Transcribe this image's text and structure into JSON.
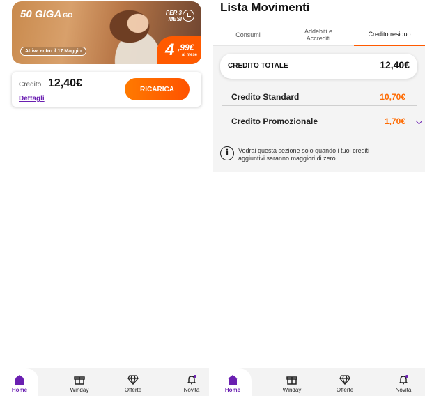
{
  "left": {
    "promo": {
      "giga": "50 GIGA",
      "go": "GO",
      "per_line1": "PER 3",
      "per_line2": "MESI",
      "attiva": "Attiva entro il 17 Maggio",
      "price_int": "4",
      "price_dec": ",99€",
      "price_suffix": "al mese"
    },
    "credit": {
      "label": "Credito",
      "value": "12,40€",
      "details_link": "Dettagli",
      "button": "RICARICA"
    }
  },
  "right": {
    "title": "Lista Movimenti",
    "tabs": [
      {
        "line1": "Consumi",
        "line2": ""
      },
      {
        "line1": "Addebiti e",
        "line2": "Accrediti"
      },
      {
        "line1": "Credito residuo",
        "line2": ""
      }
    ],
    "total": {
      "label": "CREDITO TOTALE",
      "value": "12,40€"
    },
    "rows": [
      {
        "label": "Credito Standard",
        "value": "10,70€"
      },
      {
        "label": "Credito Promozionale",
        "value": "1,70€"
      }
    ],
    "info": "Vedrai questa sezione solo quando i tuoi crediti aggiuntivi saranno maggiori di zero."
  },
  "nav": {
    "items": [
      {
        "label": "Home",
        "icon": "home-icon"
      },
      {
        "label": "Winday",
        "icon": "gift-icon"
      },
      {
        "label": "Offerte",
        "icon": "diamond-icon"
      },
      {
        "label": "Novità",
        "icon": "bell-icon"
      }
    ]
  },
  "colors": {
    "accent_purple": "#6a1fb1",
    "accent_orange": "#ff5a00"
  }
}
